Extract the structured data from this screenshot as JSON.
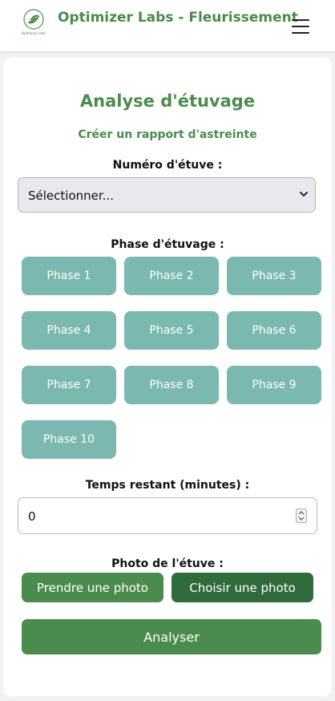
{
  "header": {
    "brand": "Optimizer Labs - Fleurissement",
    "logo_text": "Optimizer Labs"
  },
  "main": {
    "title": "Analyse d'étuvage",
    "subtitle": "Créer un rapport d'astreinte",
    "etuve": {
      "label": "Numéro d'étuve :",
      "selected": "Sélectionner..."
    },
    "phase": {
      "label": "Phase d'étuvage :",
      "buttons": [
        "Phase 1",
        "Phase 2",
        "Phase 3",
        "Phase 4",
        "Phase 5",
        "Phase 6",
        "Phase 7",
        "Phase 8",
        "Phase 9",
        "Phase 10"
      ]
    },
    "temps": {
      "label": "Temps restant (minutes) :",
      "value": "0"
    },
    "photo": {
      "label": "Photo de l'étuve :",
      "take_label": "Prendre une photo",
      "choose_label": "Choisir une photo"
    },
    "analyze_label": "Analyser"
  },
  "colors": {
    "brand_green": "#4a8a4a",
    "phase_teal": "#7ab8b0",
    "take_photo_green": "#4b8b4d",
    "choose_photo_green": "#2f6b3b",
    "analyze_green": "#4b8b4d"
  }
}
